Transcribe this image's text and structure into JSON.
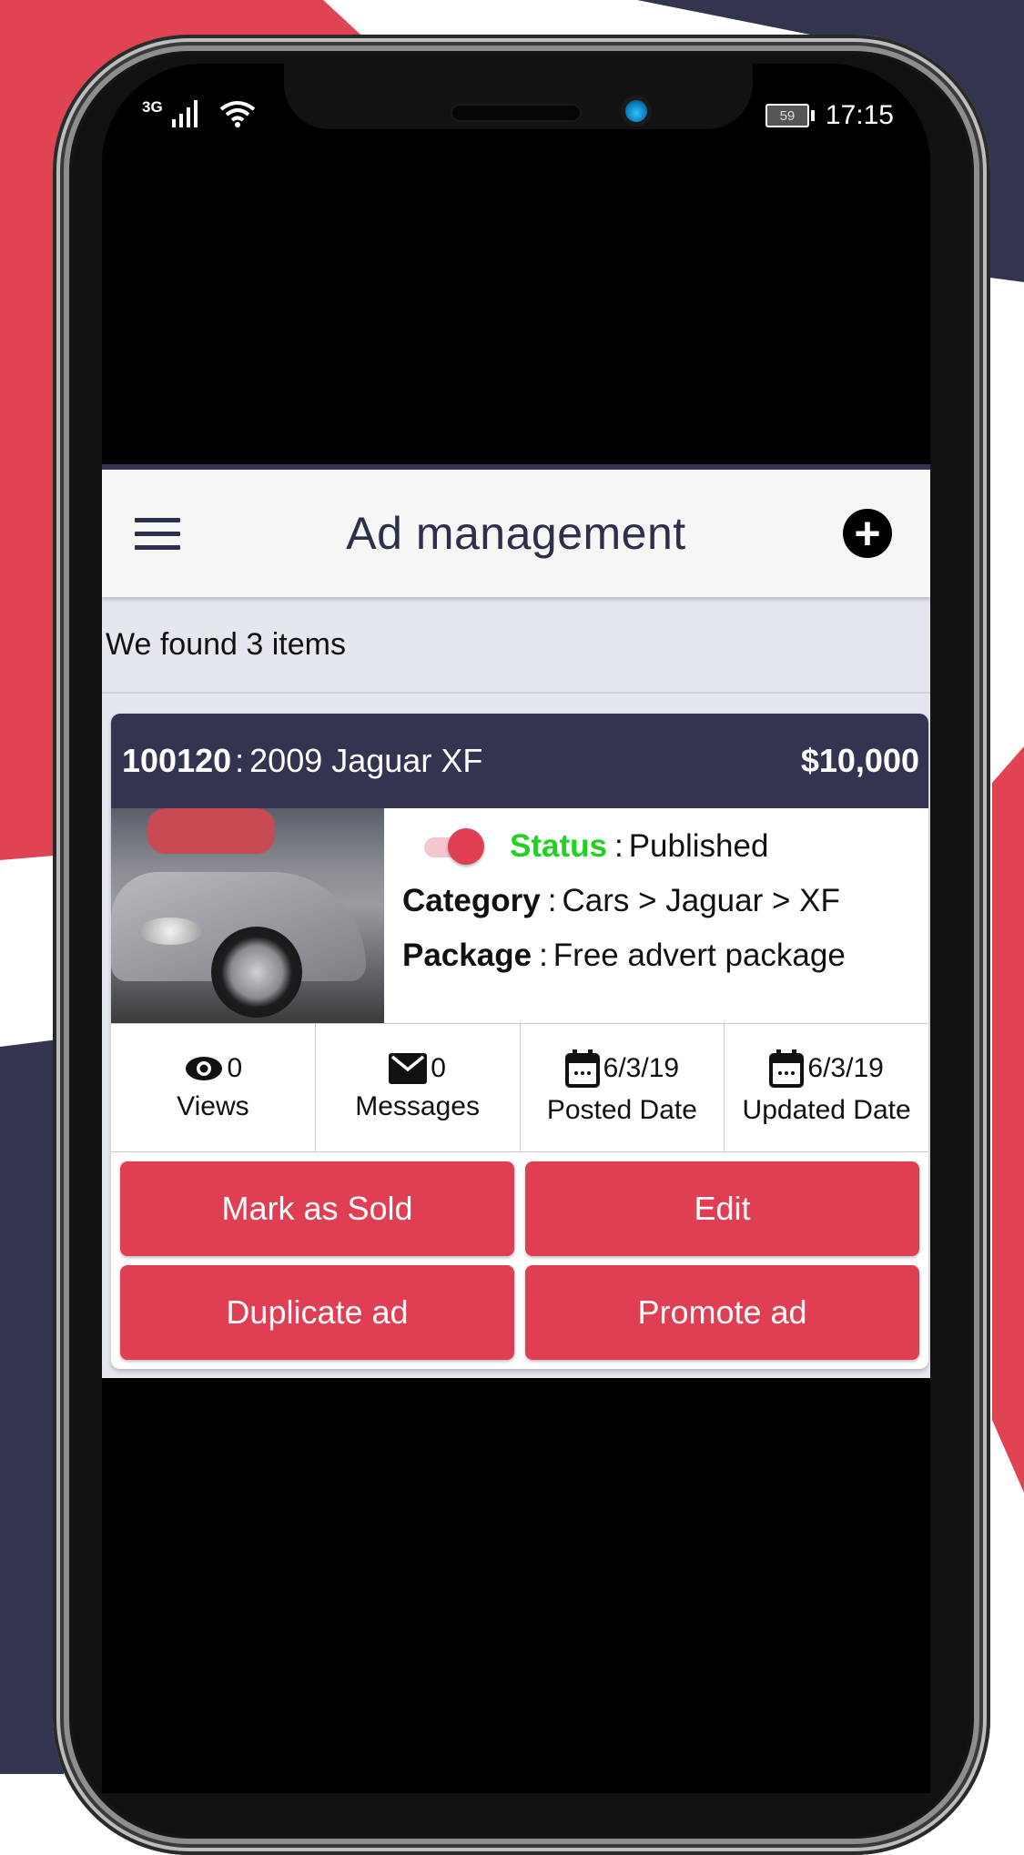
{
  "colors": {
    "brand_navy": "#33344f",
    "accent_red": "#e03e52",
    "status_green": "#1fd31f",
    "page_bg": "#e4e7ee"
  },
  "status_bar": {
    "network": "3G",
    "battery": "59",
    "time": "17:15"
  },
  "app_bar": {
    "title": "Ad management",
    "menu_icon": "hamburger-icon",
    "add_icon": "plus-circle-icon",
    "add_symbol": "+"
  },
  "results": {
    "summary": "We found 3 items"
  },
  "ad": {
    "id": "100120",
    "id_sep": ":",
    "name": "2009 Jaguar XF",
    "price": "$10,000",
    "status_label": "Status",
    "status_value": "Published",
    "status_toggle_on": true,
    "category_label": "Category",
    "category_value": "Cars > Jaguar > XF",
    "package_label": "Package",
    "package_value": "Free advert package",
    "colon": ":",
    "stats": [
      {
        "icon": "eye-icon",
        "value": "0",
        "label": "Views"
      },
      {
        "icon": "envelope-icon",
        "value": "0",
        "label": "Messages"
      },
      {
        "icon": "calendar-icon",
        "value": "6/3/19",
        "label": "Posted Date"
      },
      {
        "icon": "calendar-icon",
        "value": "6/3/19",
        "label": "Updated Date"
      }
    ],
    "actions": [
      {
        "label": "Mark as Sold"
      },
      {
        "label": "Edit"
      },
      {
        "label": "Duplicate ad"
      },
      {
        "label": "Promote ad"
      }
    ]
  }
}
